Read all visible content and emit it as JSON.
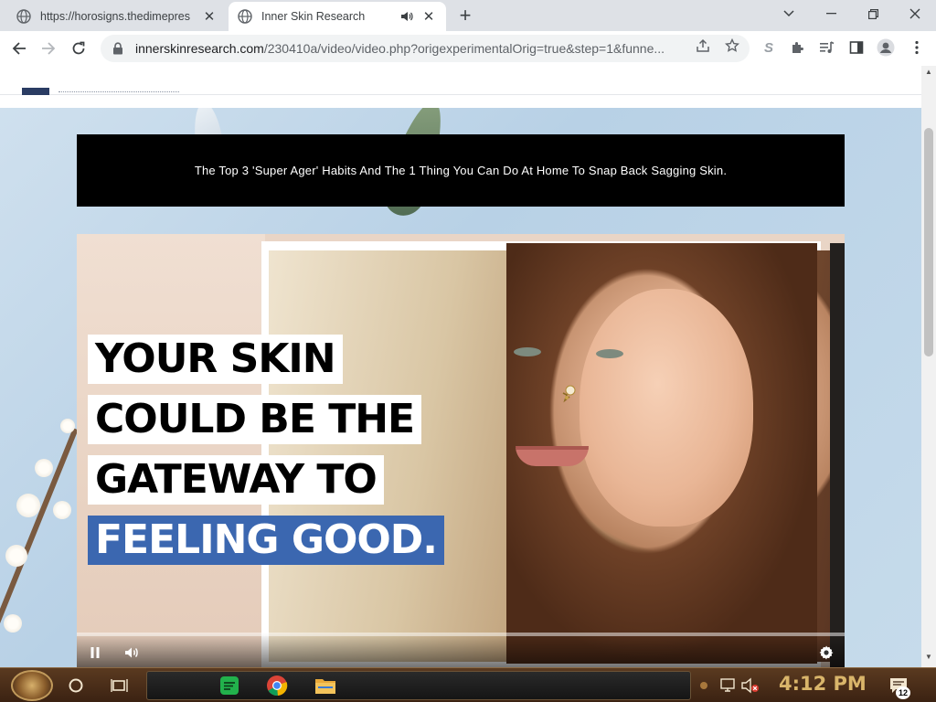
{
  "browser": {
    "tabs": [
      {
        "title": "https://horosigns.thedimepres",
        "active": false
      },
      {
        "title": "Inner Skin Research",
        "active": true
      }
    ],
    "omnibox": {
      "domain": "innerskinresearch.com",
      "path": "/230410a/video/video.php?origexperimentalOrig=true&step=1&funne..."
    }
  },
  "page": {
    "headline": "The Top 3 'Super Ager' Habits And The 1 Thing You Can Do At Home To Snap Back Sagging Skin.",
    "video": {
      "caption_lines": [
        "YOUR SKIN",
        "COULD BE THE",
        "GATEWAY TO",
        "FEELING GOOD."
      ],
      "state": "playing"
    }
  },
  "taskbar": {
    "clock": "4:12 PM",
    "notification_count": "12"
  },
  "colors": {
    "headline_bg": "#000000",
    "caption_highlight": "#3b67b0",
    "clock": "#d9b56a"
  }
}
